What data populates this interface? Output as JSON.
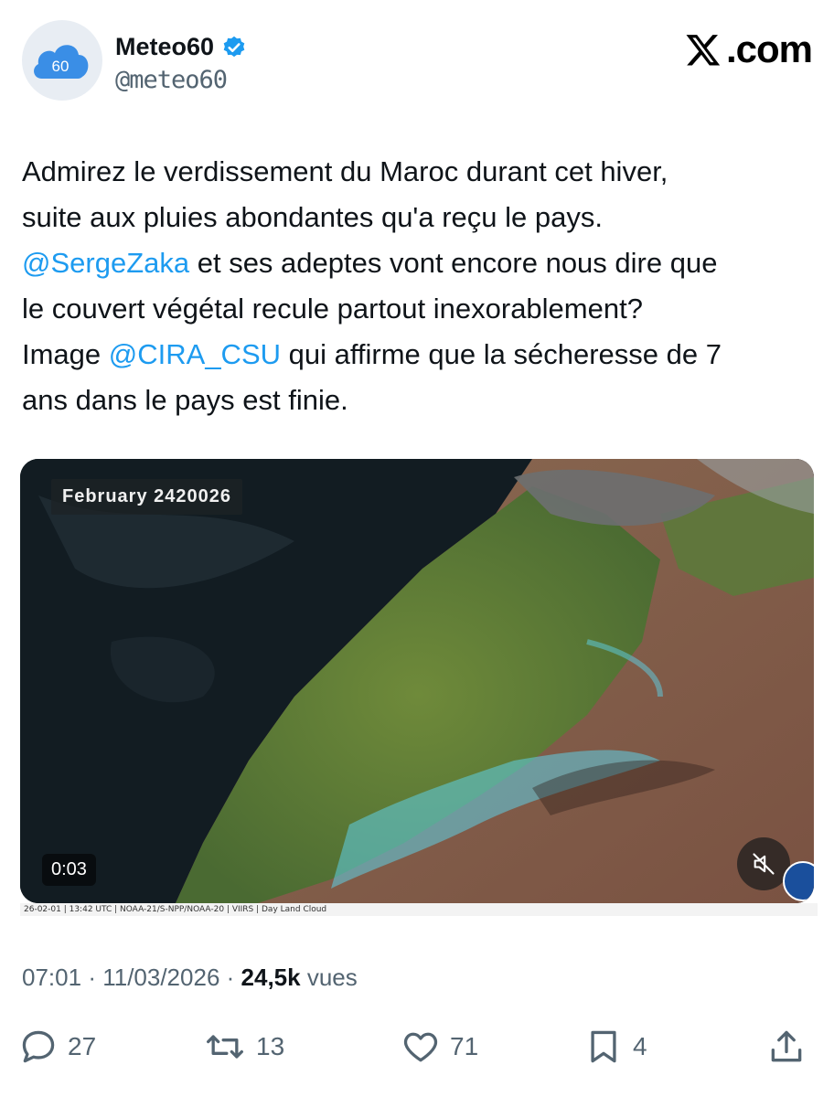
{
  "account": {
    "display_name": "Meteo60",
    "handle": "@meteo60",
    "avatar_text": "60",
    "verified": true
  },
  "brand": {
    "label": ".com"
  },
  "tweet": {
    "line1": "Admirez le verdissement du Maroc durant cet hiver,",
    "line2": "suite aux pluies abondantes qu'a reçu le pays.",
    "mention1": "@SergeZaka",
    "line3_rest": " et ses adeptes vont encore nous dire que",
    "line4": "le couvert végétal recule partout inexorablement?",
    "line5_start": "Image ",
    "mention2": "@CIRA_CSU",
    "line5_rest": " qui affirme que la sécheresse de 7",
    "line6": "ans dans le pays est finie."
  },
  "media": {
    "date_label": "February 2420026",
    "time": "0:03",
    "caption": "26-02-01 | 13:42 UTC | NOAA-21/S-NPP/NOAA-20 | VIIRS | Day Land Cloud"
  },
  "meta": {
    "time": "07:01",
    "date": "11/03/2026",
    "views_count": "24,5k",
    "views_label": "vues"
  },
  "actions": {
    "replies": "27",
    "reposts": "13",
    "likes": "71",
    "bookmarks": "4"
  },
  "colors": {
    "accent": "#1d9bf0",
    "text": "#0f1419",
    "muted": "#536471"
  }
}
